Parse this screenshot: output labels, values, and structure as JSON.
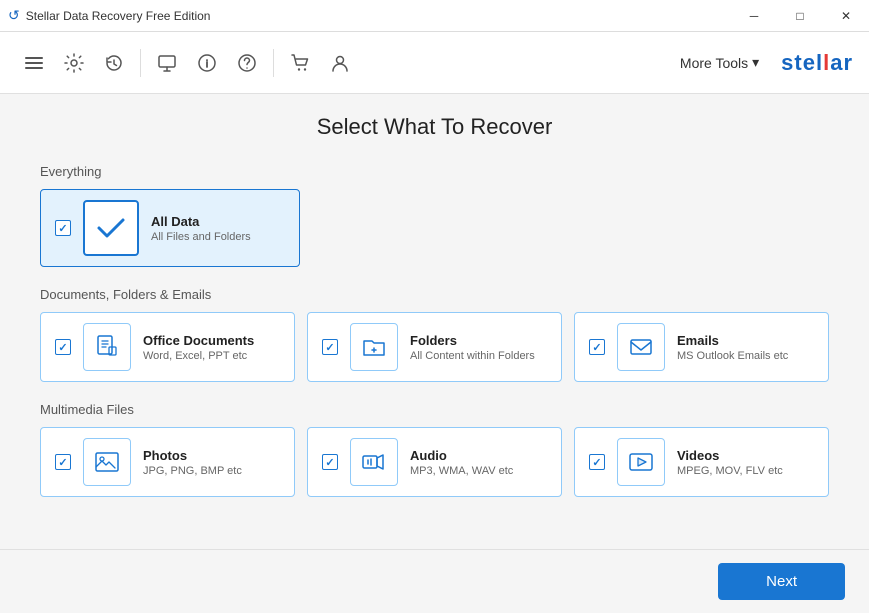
{
  "titlebar": {
    "icon": "↺",
    "title": "Stellar Data Recovery Free Edition",
    "btn_minimize": "─",
    "btn_maximize": "□",
    "btn_close": "✕"
  },
  "toolbar": {
    "more_tools_label": "More Tools",
    "more_tools_arrow": "▾",
    "logo_main": "stellar",
    "logo_accent": "!"
  },
  "page": {
    "title": "Select What To Recover"
  },
  "sections": {
    "everything": {
      "label": "Everything",
      "cards": [
        {
          "id": "all-data",
          "title": "All Data",
          "subtitle": "All Files and Folders",
          "checked": true,
          "selected": true
        }
      ]
    },
    "documents": {
      "label": "Documents, Folders & Emails",
      "cards": [
        {
          "id": "office-docs",
          "title": "Office Documents",
          "subtitle": "Word, Excel, PPT etc",
          "checked": true,
          "selected": false
        },
        {
          "id": "folders",
          "title": "Folders",
          "subtitle": "All Content within Folders",
          "checked": true,
          "selected": false
        },
        {
          "id": "emails",
          "title": "Emails",
          "subtitle": "MS Outlook Emails etc",
          "checked": true,
          "selected": false
        }
      ]
    },
    "multimedia": {
      "label": "Multimedia Files",
      "cards": [
        {
          "id": "photos",
          "title": "Photos",
          "subtitle": "JPG, PNG, BMP etc",
          "checked": true,
          "selected": false
        },
        {
          "id": "audio",
          "title": "Audio",
          "subtitle": "MP3, WMA, WAV etc",
          "checked": true,
          "selected": false
        },
        {
          "id": "videos",
          "title": "Videos",
          "subtitle": "MPEG, MOV, FLV etc",
          "checked": true,
          "selected": false
        }
      ]
    }
  },
  "footer": {
    "next_label": "Next"
  }
}
